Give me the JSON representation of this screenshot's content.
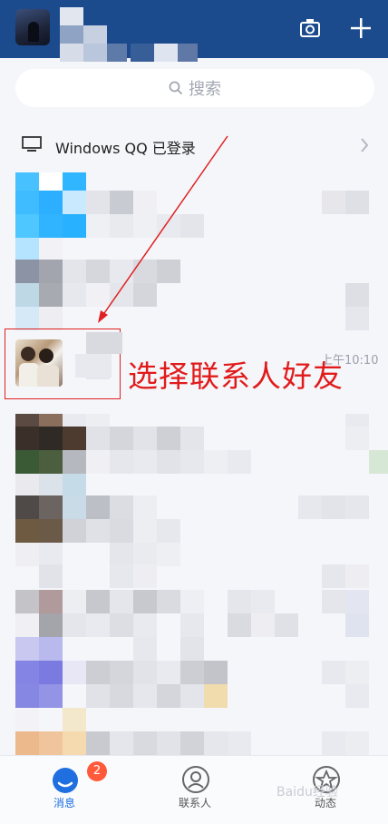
{
  "search": {
    "placeholder": "搜索"
  },
  "device_banner": {
    "label": "Windows QQ 已登录"
  },
  "selected_contact": {
    "time": "上午10:10"
  },
  "annotation": {
    "text": "选择联系人好友"
  },
  "tabbar": {
    "tabs": [
      {
        "label": "消息",
        "badge": "2",
        "active": true
      },
      {
        "label": "联系人",
        "active": false
      },
      {
        "label": "动态",
        "active": false
      }
    ]
  },
  "colors": {
    "header": "#1b4b8c",
    "accent": "#1f6fe0",
    "badge": "#ff5a3a",
    "annotation": "#e11b1b"
  },
  "watermark": {
    "text": "Baidu经验"
  }
}
